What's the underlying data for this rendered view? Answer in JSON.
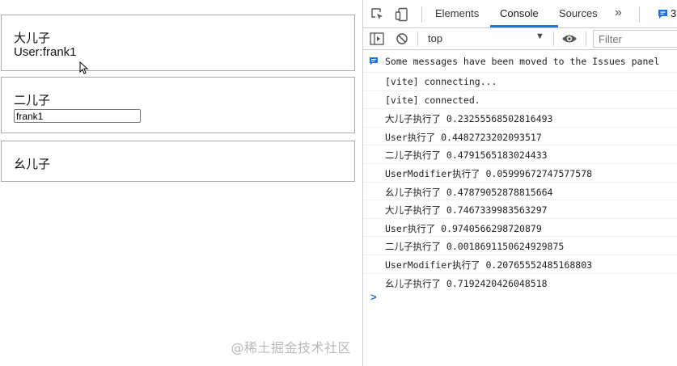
{
  "page": {
    "box1": {
      "title": "大儿子",
      "user_text": "User:frank1"
    },
    "box2": {
      "title": "二儿子",
      "input_value": "frank1"
    },
    "box3": {
      "title": "幺儿子"
    },
    "watermark": "@稀土掘金技术社区"
  },
  "devtools": {
    "tabs": [
      {
        "label": "Elements"
      },
      {
        "label": "Console",
        "active": true
      },
      {
        "label": "Sources"
      }
    ],
    "more_label": "»",
    "issues_count": "3",
    "context": "top",
    "filter_placeholder": "Filter",
    "issues_message": "Some messages have been moved to the Issues panel",
    "logs": [
      "[vite] connecting...",
      "[vite] connected.",
      "大儿子执行了 0.23255568502816493",
      "User执行了 0.4482723202093517",
      "二儿子执行了 0.4791565183024433",
      "UserModifier执行了 0.05999672747577578",
      "幺儿子执行了 0.47879052878815664",
      "大儿子执行了 0.7467339983563297",
      "User执行了 0.9740566298720879",
      "二儿子执行了 0.0018691150624929875",
      "UserModifier执行了 0.20765552485168803",
      "幺儿子执行了 0.7192420426048518"
    ],
    "prompt": ">"
  },
  "colors": {
    "accent": "#1a73e8",
    "border": "#a9a9a9"
  }
}
